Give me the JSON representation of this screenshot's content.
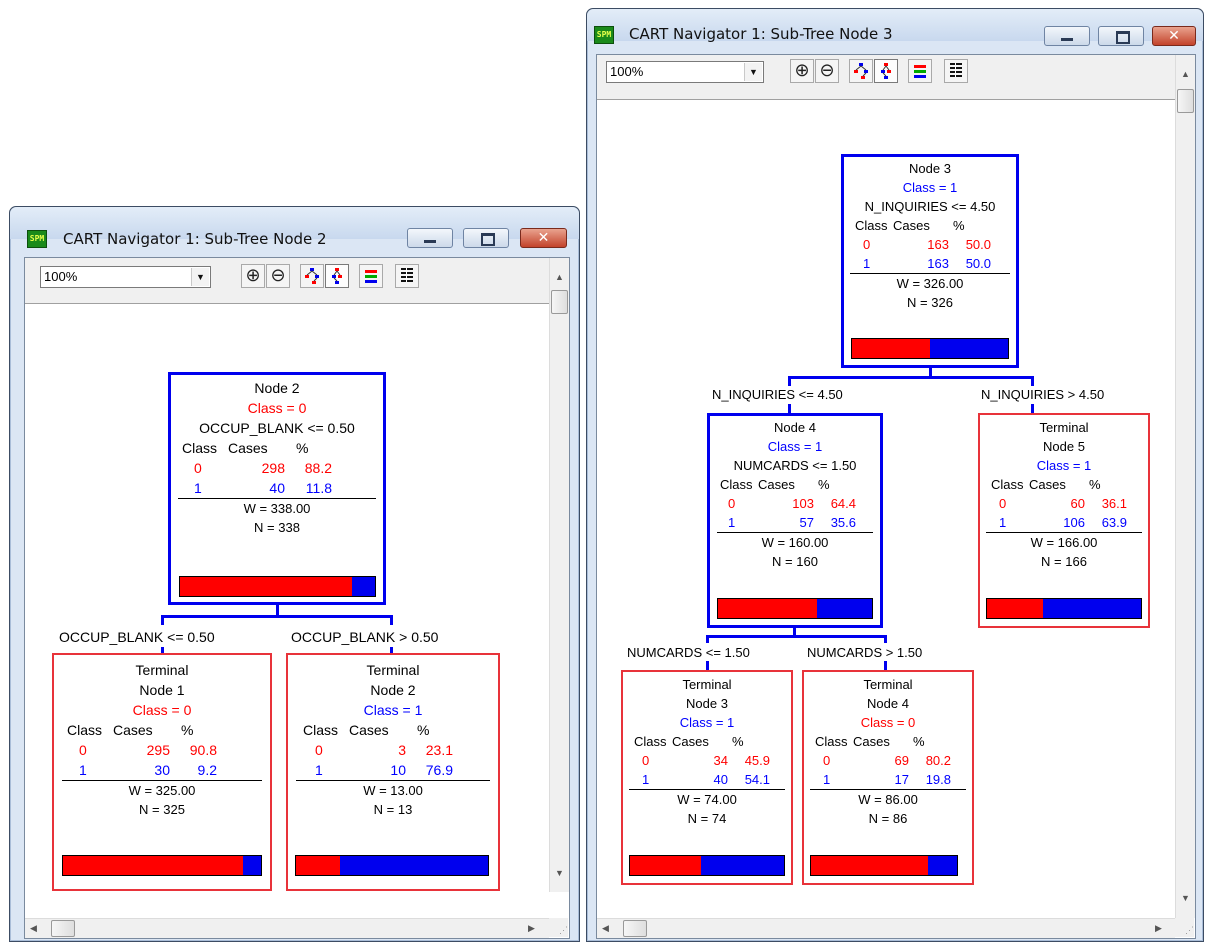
{
  "windows": [
    {
      "title": "CART Navigator 1: Sub-Tree Node 2",
      "zoom": "100%",
      "root": {
        "name": "Node 2",
        "class_label": "Class = 0",
        "split": "OCCUP_BLANK <= 0.50",
        "header": [
          "Class",
          "Cases",
          "%"
        ],
        "rows": [
          [
            "0",
            "298",
            "88.2"
          ],
          [
            "1",
            "40",
            "11.8"
          ]
        ],
        "weight": "W = 338.00",
        "n": "N = 338",
        "bar_class0_fraction": 0.882
      },
      "left_label": "OCCUP_BLANK <= 0.50",
      "right_label": "OCCUP_BLANK >  0.50",
      "terminals": [
        {
          "title1": "Terminal",
          "title2": "Node 1",
          "class_label": "Class = 0",
          "header": [
            "Class",
            "Cases",
            "%"
          ],
          "rows": [
            [
              "0",
              "295",
              "90.8"
            ],
            [
              "1",
              "30",
              "9.2"
            ]
          ],
          "weight": "W = 325.00",
          "n": "N = 325",
          "bar_class0_fraction": 0.908
        },
        {
          "title1": "Terminal",
          "title2": "Node 2",
          "class_label": "Class = 1",
          "header": [
            "Class",
            "Cases",
            "%"
          ],
          "rows": [
            [
              "0",
              "3",
              "23.1"
            ],
            [
              "1",
              "10",
              "76.9"
            ]
          ],
          "weight": "W = 13.00",
          "n": "N = 13",
          "bar_class0_fraction": 0.231
        }
      ]
    },
    {
      "title": "CART Navigator 1: Sub-Tree Node 3",
      "zoom": "100%",
      "root": {
        "name": "Node 3",
        "class_label": "Class = 1",
        "split": "N_INQUIRIES <= 4.50",
        "header": [
          "Class",
          "Cases",
          "%"
        ],
        "rows": [
          [
            "0",
            "163",
            "50.0"
          ],
          [
            "1",
            "163",
            "50.0"
          ]
        ],
        "weight": "W = 326.00",
        "n": "N = 326",
        "bar_class0_fraction": 0.5
      },
      "left_label": "N_INQUIRIES <= 4.50",
      "right_label": "N_INQUIRIES >  4.50",
      "node4": {
        "name": "Node 4",
        "class_label": "Class = 1",
        "split": "NUMCARDS <= 1.50",
        "header": [
          "Class",
          "Cases",
          "%"
        ],
        "rows": [
          [
            "0",
            "103",
            "64.4"
          ],
          [
            "1",
            "57",
            "35.6"
          ]
        ],
        "weight": "W = 160.00",
        "n": "N = 160",
        "bar_class0_fraction": 0.644
      },
      "node4_left_label": "NUMCARDS <= 1.50",
      "node4_right_label": "NUMCARDS >  1.50",
      "terminals": [
        {
          "title1": "Terminal",
          "title2": "Node 5",
          "class_label": "Class = 1",
          "header": [
            "Class",
            "Cases",
            "%"
          ],
          "rows": [
            [
              "0",
              "60",
              "36.1"
            ],
            [
              "1",
              "106",
              "63.9"
            ]
          ],
          "weight": "W = 166.00",
          "n": "N = 166",
          "bar_class0_fraction": 0.361
        },
        {
          "title1": "Terminal",
          "title2": "Node 3",
          "class_label": "Class = 1",
          "header": [
            "Class",
            "Cases",
            "%"
          ],
          "rows": [
            [
              "0",
              "34",
              "45.9"
            ],
            [
              "1",
              "40",
              "54.1"
            ]
          ],
          "weight": "W = 74.00",
          "n": "N = 74",
          "bar_class0_fraction": 0.459
        },
        {
          "title1": "Terminal",
          "title2": "Node 4",
          "class_label": "Class = 0",
          "header": [
            "Class",
            "Cases",
            "%"
          ],
          "rows": [
            [
              "0",
              "69",
              "80.2"
            ],
            [
              "1",
              "17",
              "19.8"
            ]
          ],
          "weight": "W = 86.00",
          "n": "N = 86",
          "bar_class0_fraction": 0.802
        }
      ]
    }
  ],
  "app_icon_text": "SPM",
  "colors": {
    "class0": "#ff0000",
    "class1": "#0000ee",
    "split_border": "#0000ee",
    "terminal_border": "#e8333a"
  }
}
